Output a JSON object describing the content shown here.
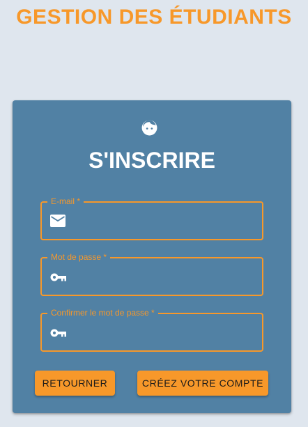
{
  "app": {
    "title": "GESTION DES ÉTUDIANTS"
  },
  "card": {
    "icon": "face-icon",
    "title": "S'INSCRIRE"
  },
  "form": {
    "email": {
      "label": "E-mail *",
      "value": "",
      "icon": "mail-icon"
    },
    "password": {
      "label": "Mot de passe *",
      "value": "",
      "icon": "key-icon"
    },
    "confirm_password": {
      "label": "Confirmer le mot de passe *",
      "value": "",
      "icon": "key-icon"
    }
  },
  "actions": {
    "back_label": "RETOURNER",
    "create_label": "CRÉEZ VOTRE COMPTE"
  },
  "colors": {
    "accent": "#f7982a",
    "card_background": "#5181a4",
    "page_background": "#dfe6ee",
    "text_light": "#ffffff"
  }
}
